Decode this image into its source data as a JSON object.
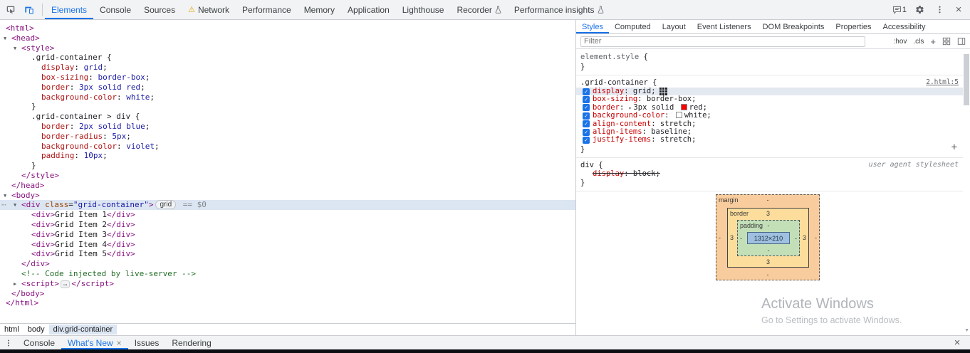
{
  "toolbar": {
    "tabs": [
      {
        "label": "Elements",
        "active": true
      },
      {
        "label": "Console"
      },
      {
        "label": "Sources"
      },
      {
        "label": "Network",
        "warning": true
      },
      {
        "label": "Performance"
      },
      {
        "label": "Memory"
      },
      {
        "label": "Application"
      },
      {
        "label": "Lighthouse"
      },
      {
        "label": "Recorder",
        "experiment": true
      },
      {
        "label": "Performance insights",
        "experiment": true
      }
    ],
    "messages_count": "1"
  },
  "elements_tree": {
    "lines": [
      {
        "n": "tree-node-html",
        "d": 0,
        "seg": [
          {
            "t": "<html>",
            "c": "tag"
          }
        ]
      },
      {
        "n": "tree-node-head",
        "d": 1,
        "a": "open",
        "seg": [
          {
            "t": "<head>",
            "c": "tag"
          }
        ]
      },
      {
        "n": "tree-node-style",
        "d": 2,
        "a": "open",
        "seg": [
          {
            "t": "<style>",
            "c": "tag"
          }
        ]
      },
      {
        "n": "css-text-line",
        "d": 3,
        "seg": [
          {
            "t": ".grid-container {",
            "c": "plain"
          }
        ]
      },
      {
        "n": "css-text-line",
        "d": 4,
        "seg": [
          {
            "t": "display",
            "c": "cssprop"
          },
          {
            "t": ": ",
            "c": "plain"
          },
          {
            "t": "grid",
            "c": "cssval"
          },
          {
            "t": ";",
            "c": "plain"
          }
        ]
      },
      {
        "n": "css-text-line",
        "d": 4,
        "seg": [
          {
            "t": "box-sizing",
            "c": "cssprop"
          },
          {
            "t": ": ",
            "c": "plain"
          },
          {
            "t": "border-box",
            "c": "cssval"
          },
          {
            "t": ";",
            "c": "plain"
          }
        ]
      },
      {
        "n": "css-text-line",
        "d": 4,
        "seg": [
          {
            "t": "border",
            "c": "cssprop"
          },
          {
            "t": ": ",
            "c": "plain"
          },
          {
            "t": "3px solid red",
            "c": "cssval"
          },
          {
            "t": ";",
            "c": "plain"
          }
        ]
      },
      {
        "n": "css-text-line",
        "d": 4,
        "seg": [
          {
            "t": "background-color",
            "c": "cssprop"
          },
          {
            "t": ": ",
            "c": "plain"
          },
          {
            "t": "white",
            "c": "cssval"
          },
          {
            "t": ";",
            "c": "plain"
          }
        ]
      },
      {
        "n": "css-text-line",
        "d": 3,
        "seg": [
          {
            "t": "}",
            "c": "plain"
          }
        ]
      },
      {
        "n": "css-text-line",
        "d": 3,
        "seg": [
          {
            "t": ".grid-container > div {",
            "c": "plain"
          }
        ]
      },
      {
        "n": "css-text-line",
        "d": 4,
        "seg": [
          {
            "t": "border",
            "c": "cssprop"
          },
          {
            "t": ": ",
            "c": "plain"
          },
          {
            "t": "2px solid blue",
            "c": "cssval"
          },
          {
            "t": ";",
            "c": "plain"
          }
        ]
      },
      {
        "n": "css-text-line",
        "d": 4,
        "seg": [
          {
            "t": "border-radius",
            "c": "cssprop"
          },
          {
            "t": ": ",
            "c": "plain"
          },
          {
            "t": "5px",
            "c": "cssval"
          },
          {
            "t": ";",
            "c": "plain"
          }
        ]
      },
      {
        "n": "css-text-line",
        "d": 4,
        "seg": [
          {
            "t": "background-color",
            "c": "cssprop"
          },
          {
            "t": ": ",
            "c": "plain"
          },
          {
            "t": "violet",
            "c": "cssval"
          },
          {
            "t": ";",
            "c": "plain"
          }
        ]
      },
      {
        "n": "css-text-line",
        "d": 4,
        "seg": [
          {
            "t": "padding",
            "c": "cssprop"
          },
          {
            "t": ": ",
            "c": "plain"
          },
          {
            "t": "10px",
            "c": "cssval"
          },
          {
            "t": ";",
            "c": "plain"
          }
        ]
      },
      {
        "n": "css-text-line",
        "d": 3,
        "seg": [
          {
            "t": "}",
            "c": "plain"
          }
        ]
      },
      {
        "n": "tree-node-style-close",
        "d": 2,
        "seg": [
          {
            "t": "</style>",
            "c": "tag"
          }
        ]
      },
      {
        "n": "tree-node-head-close",
        "d": 1,
        "seg": [
          {
            "t": "</head>",
            "c": "tag"
          }
        ]
      },
      {
        "n": "tree-node-body",
        "d": 1,
        "a": "open",
        "seg": [
          {
            "t": "<body>",
            "c": "tag"
          }
        ]
      },
      {
        "n": "tree-node-div-grid-container",
        "d": 2,
        "a": "open",
        "sel": true,
        "g": true,
        "seg": [
          {
            "t": "<div ",
            "c": "tag"
          },
          {
            "t": "class",
            "c": "attr"
          },
          {
            "t": "=",
            "c": "plain"
          },
          {
            "t": "\"grid-container\"",
            "c": "attrval"
          },
          {
            "t": ">",
            "c": "tag"
          },
          {
            "t": "grid",
            "c": "badge"
          },
          {
            "t": " == $0",
            "c": "gray"
          }
        ]
      },
      {
        "n": "tree-node-grid-item-1",
        "d": 3,
        "seg": [
          {
            "t": "<div>",
            "c": "tag"
          },
          {
            "t": "Grid Item 1",
            "c": "plain"
          },
          {
            "t": "</div>",
            "c": "tag"
          }
        ]
      },
      {
        "n": "tree-node-grid-item-2",
        "d": 3,
        "seg": [
          {
            "t": "<div>",
            "c": "tag"
          },
          {
            "t": "Grid Item 2",
            "c": "plain"
          },
          {
            "t": "</div>",
            "c": "tag"
          }
        ]
      },
      {
        "n": "tree-node-grid-item-3",
        "d": 3,
        "seg": [
          {
            "t": "<div>",
            "c": "tag"
          },
          {
            "t": "Grid Item 3",
            "c": "plain"
          },
          {
            "t": "</div>",
            "c": "tag"
          }
        ]
      },
      {
        "n": "tree-node-grid-item-4",
        "d": 3,
        "seg": [
          {
            "t": "<div>",
            "c": "tag"
          },
          {
            "t": "Grid Item 4",
            "c": "plain"
          },
          {
            "t": "</div>",
            "c": "tag"
          }
        ]
      },
      {
        "n": "tree-node-grid-item-5",
        "d": 3,
        "seg": [
          {
            "t": "<div>",
            "c": "tag"
          },
          {
            "t": "Grid Item 5",
            "c": "plain"
          },
          {
            "t": "</div>",
            "c": "tag"
          }
        ]
      },
      {
        "n": "tree-node-div-close",
        "d": 2,
        "seg": [
          {
            "t": "</div>",
            "c": "tag"
          }
        ]
      },
      {
        "n": "tree-node-comment",
        "d": 2,
        "seg": [
          {
            "t": "<!-- Code injected by live-server -->",
            "c": "comment"
          }
        ]
      },
      {
        "n": "tree-node-script",
        "d": 2,
        "a": "closed",
        "seg": [
          {
            "t": "<script>",
            "c": "tag"
          },
          {
            "t": "…",
            "c": "ellipsis"
          },
          {
            "t": "</script>",
            "c": "tag"
          }
        ]
      },
      {
        "n": "tree-node-body-close",
        "d": 1,
        "seg": [
          {
            "t": "</body>",
            "c": "tag"
          }
        ]
      },
      {
        "n": "tree-node-html-close",
        "d": 0,
        "seg": [
          {
            "t": "</html>",
            "c": "tag"
          }
        ]
      }
    ]
  },
  "breadcrumbs": [
    {
      "label": "html"
    },
    {
      "label": "body"
    },
    {
      "label": "div.grid-container",
      "active": true
    }
  ],
  "styles_panel": {
    "tabs": [
      {
        "label": "Styles",
        "active": true
      },
      {
        "label": "Computed"
      },
      {
        "label": "Layout"
      },
      {
        "label": "Event Listeners"
      },
      {
        "label": "DOM Breakpoints"
      },
      {
        "label": "Properties"
      },
      {
        "label": "Accessibility"
      }
    ],
    "filter_placeholder": "Filter",
    "toggles": {
      "hov": ":hov",
      "cls": ".cls",
      "plus": "+"
    },
    "punct": {
      "open": " {",
      "close": "}",
      "colon": ": ",
      "semi": ";"
    },
    "element_style": {
      "name": "element.style"
    },
    "rules": [
      {
        "selector": ".grid-container",
        "source": "2.html:5",
        "add_button": true,
        "props": [
          {
            "name": "display",
            "value": "grid",
            "highlight": true,
            "grid_icon": true
          },
          {
            "name": "box-sizing",
            "value": "border-box"
          },
          {
            "name": "border",
            "value": "3px solid ",
            "swatch": "#ff0000",
            "value2": "red",
            "expand": true
          },
          {
            "name": "background-color",
            "value": "",
            "swatch": "#ffffff",
            "value2": "white"
          },
          {
            "name": "align-content",
            "value": "stretch"
          },
          {
            "name": "align-items",
            "value": "baseline"
          },
          {
            "name": "justify-items",
            "value": "stretch"
          }
        ]
      },
      {
        "selector": "div",
        "source": "user agent stylesheet",
        "ua": true,
        "props": [
          {
            "name": "display",
            "value": "block",
            "struck": true,
            "no_checkbox": true
          }
        ]
      }
    ]
  },
  "box_model": {
    "margin_label": "margin",
    "border_label": "border",
    "padding_label": "padding",
    "margin": "-",
    "border": "3",
    "padding": "-",
    "content": "1312×210"
  },
  "watermark": {
    "title": "Activate Windows",
    "subtitle": "Go to Settings to activate Windows."
  },
  "drawer": {
    "tabs": [
      {
        "label": "Console"
      },
      {
        "label": "What's New",
        "active": true,
        "closable": true
      },
      {
        "label": "Issues"
      },
      {
        "label": "Rendering"
      }
    ]
  }
}
